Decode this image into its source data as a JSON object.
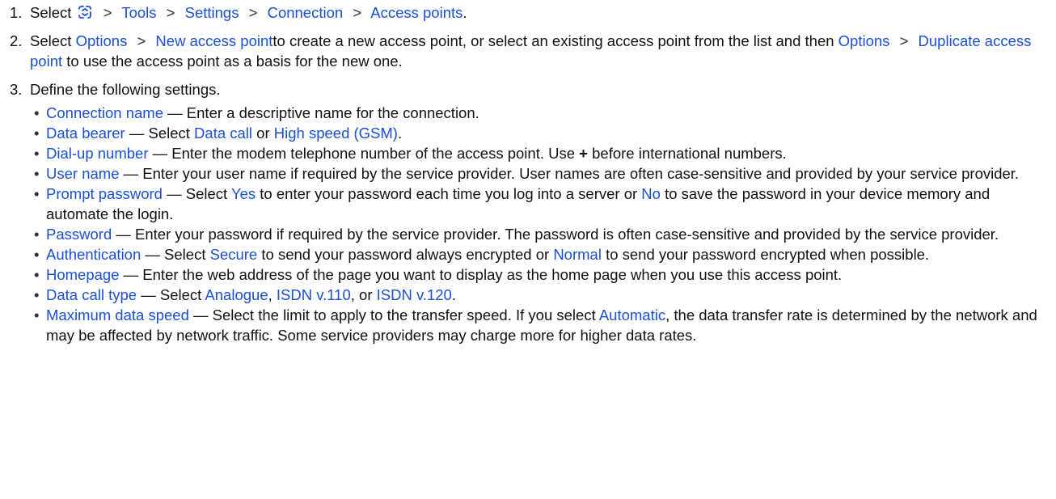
{
  "steps": [
    {
      "number": "1.",
      "select": "Select",
      "path": [
        "Tools",
        "Settings",
        "Connection",
        "Access points"
      ],
      "end": "."
    },
    {
      "number": "2.",
      "select": "Select",
      "opt1": "Options",
      "new_ap": "New access point",
      "mid": "to create a new access point, or select an existing access point from the list and then",
      "opt2": "Options",
      "dup_ap": "Duplicate access point",
      "tail": " to use the access point as a basis for the new one."
    },
    {
      "number": "3.",
      "text": "Define the following settings."
    }
  ],
  "separator": ">",
  "dash": " — ",
  "menu_icon": "menu-key-icon",
  "accent_color": "#1a4fd8",
  "settings": [
    {
      "name": "Connection name",
      "parts": [
        {
          "t": " Enter a descriptive name for the connection."
        }
      ]
    },
    {
      "name": "Data bearer",
      "parts": [
        {
          "t": "Select "
        },
        {
          "b": "Data call"
        },
        {
          "t": " or "
        },
        {
          "b": "High speed (GSM)"
        },
        {
          "t": "."
        }
      ]
    },
    {
      "name": "Dial-up number",
      "parts": [
        {
          "t": "Enter the modem telephone number of the access point. Use "
        },
        {
          "s": "+"
        },
        {
          "t": " before international numbers."
        }
      ]
    },
    {
      "name": "User name",
      "parts": [
        {
          "t": "Enter your user name if required by the service provider. User names are often case-sensitive and provided by your service provider."
        }
      ]
    },
    {
      "name": "Prompt password",
      "parts": [
        {
          "t": "Select "
        },
        {
          "b": "Yes"
        },
        {
          "t": " to enter your password each time you log into a server or "
        },
        {
          "b": "No"
        },
        {
          "t": " to save the password in your device memory and automate the login."
        }
      ]
    },
    {
      "name": "Password",
      "parts": [
        {
          "t": "Enter your password if required by the service provider. The password is often case-sensitive and provided by the service provider."
        }
      ]
    },
    {
      "name": "Authentication",
      "parts": [
        {
          "t": "Select "
        },
        {
          "b": "Secure"
        },
        {
          "t": " to send your password always encrypted or "
        },
        {
          "b": "Normal"
        },
        {
          "t": " to send your password encrypted when possible."
        }
      ]
    },
    {
      "name": "Homepage",
      "parts": [
        {
          "t": "Enter the web address of the page you want to display as the home page when you use this access point."
        }
      ]
    },
    {
      "name": "Data call type",
      "parts": [
        {
          "t": "Select "
        },
        {
          "b": "Analogue"
        },
        {
          "t": ", "
        },
        {
          "b": "ISDN v.110"
        },
        {
          "t": ", or "
        },
        {
          "b": "ISDN v.120"
        },
        {
          "t": "."
        }
      ]
    },
    {
      "name": "Maximum data speed",
      "parts": [
        {
          "t": "Select the limit to apply to the transfer speed. If you select "
        },
        {
          "b": "Automatic"
        },
        {
          "t": ", the data transfer rate is determined by the network and may be affected by network traffic. Some service providers may charge more for higher data rates."
        }
      ]
    }
  ]
}
